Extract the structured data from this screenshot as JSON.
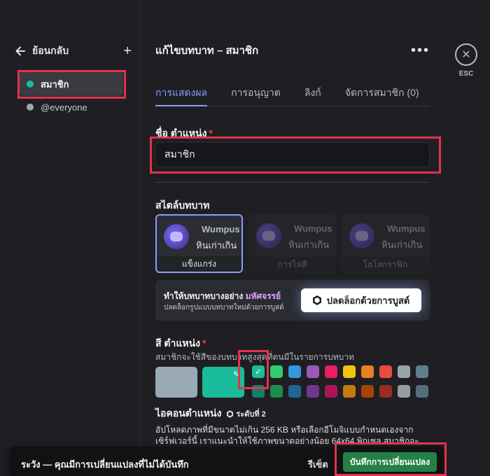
{
  "sidebar": {
    "back_label": "ย้อนกลับ",
    "add_symbol": "+",
    "roles": [
      {
        "name": "สมาชิก",
        "color": "#1abc9c"
      },
      {
        "name": "@everyone",
        "color": "#99aab5"
      }
    ]
  },
  "header": {
    "title": "แก้ไขบทบาท – สมาชิก",
    "more_symbol": "•••"
  },
  "tabs": [
    {
      "label": "การแสดงผล",
      "active": true
    },
    {
      "label": "การอนุญาต"
    },
    {
      "label": "ลิงก์"
    },
    {
      "label": "จัดการสมาชิก (0)"
    }
  ],
  "role_name": {
    "label": "ชื่อ ตำแหน่ง",
    "required": "*",
    "value": "สมาชิก"
  },
  "role_style": {
    "label": "สไตล์บทบาท",
    "cards": [
      {
        "username": "Wumpus",
        "role_text": "หินเก่าเกิน",
        "caption": "แข็งแกร่ง"
      },
      {
        "username": "Wumpus",
        "role_text": "หินเก่าเกิน",
        "caption": "การไล่สี"
      },
      {
        "username": "Wumpus",
        "role_text": "หินเก่าเกิน",
        "caption": "โฮโลกราฟิก"
      }
    ]
  },
  "boost": {
    "headline": "ทำให้บทบาทบางอย่าง ",
    "headline_magic": "มหัศจรรย์",
    "sub": "ปลดล็อกรูปแบบบทบาทใหม่ด้วยการบูสต์",
    "button": "ปลดล็อกด้วยการบูสต์"
  },
  "role_color": {
    "label": "สี ตำแหน่ง",
    "required": "*",
    "description": "สมาชิกจะใช้สีของบทบาทสูงสุดที่ตนมีในรายการบทบาท",
    "default_color": "#99aab5",
    "selected_color": "#1abc9c",
    "pencil_symbol": "✎",
    "check_symbol": "✓",
    "palette_top": [
      "#1abc9c",
      "#2ecc71",
      "#3498db",
      "#9b59b6",
      "#e91e63",
      "#f1c40f",
      "#e67e22",
      "#e74c3c",
      "#95a5a6",
      "#607d8b"
    ],
    "palette_bottom": [
      "#11806a",
      "#1f8b4c",
      "#206694",
      "#71368a",
      "#ad1457",
      "#c27c0e",
      "#a84300",
      "#992d22",
      "#979c9f",
      "#546e7a"
    ]
  },
  "role_icon": {
    "label": "ไอคอนตำแหน่ง",
    "level": "ระดับที่ 2",
    "description": "อัปโหลดภาพที่มีขนาดไม่เกิน 256 KB หรือเลือกอีโมจิแบบกำหนดเองจากเซิร์ฟเวอร์นี้ เราแนะนำให้ใช้ภาพขนาดอย่างน้อย 64x64 พิกเซล สมาชิกจะเห็น"
  },
  "close": {
    "symbol": "✕",
    "esc": "ESC"
  },
  "save_bar": {
    "message": "ระวัง — คุณมีการเปลี่ยนแปลงที่ไม่ได้บันทึก",
    "reset": "รีเซ็ต",
    "save": "บันทึกการเปลี่ยนแปลง"
  }
}
